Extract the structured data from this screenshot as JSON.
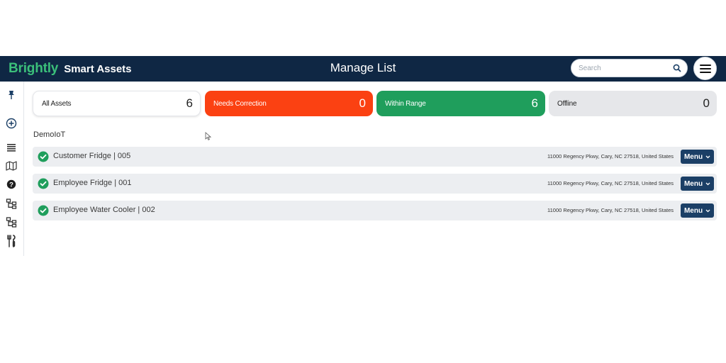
{
  "header": {
    "brand": "Brightly",
    "product": "Smart Assets",
    "title": "Manage List",
    "search_placeholder": "Search"
  },
  "sidebar": {
    "icons": [
      "pin-icon",
      "add-circle-icon",
      "list-icon",
      "map-icon",
      "help-icon",
      "org-chart-icon",
      "org-chart-icon",
      "tools-icon"
    ]
  },
  "summary": {
    "all_assets": {
      "label": "All Assets",
      "count": "6"
    },
    "needs_correction": {
      "label": "Needs Correction",
      "count": "0"
    },
    "within_range": {
      "label": "Within Range",
      "count": "6"
    },
    "offline": {
      "label": "Offline",
      "count": "0"
    }
  },
  "group": {
    "name": "DemoIoT"
  },
  "assets": [
    {
      "name": "Customer Fridge | 005",
      "address": "11000 Regency Pkwy, Cary, NC 27518, United States",
      "menu_label": "Menu",
      "status": "within-range"
    },
    {
      "name": "Employee Fridge | 001",
      "address": "11000 Regency Pkwy, Cary, NC 27518, United States",
      "menu_label": "Menu",
      "status": "within-range"
    },
    {
      "name": "Employee Water Cooler | 002",
      "address": "11000 Regency Pkwy, Cary, NC 27518, United States",
      "menu_label": "Menu",
      "status": "within-range"
    }
  ],
  "colors": {
    "header_bg": "#0f2744",
    "brand_green": "#3bbf7a",
    "needs_correction": "#fb4112",
    "within_range": "#1f9e5c",
    "offline": "#e6e7ea",
    "menu_button": "#1b3f66"
  }
}
